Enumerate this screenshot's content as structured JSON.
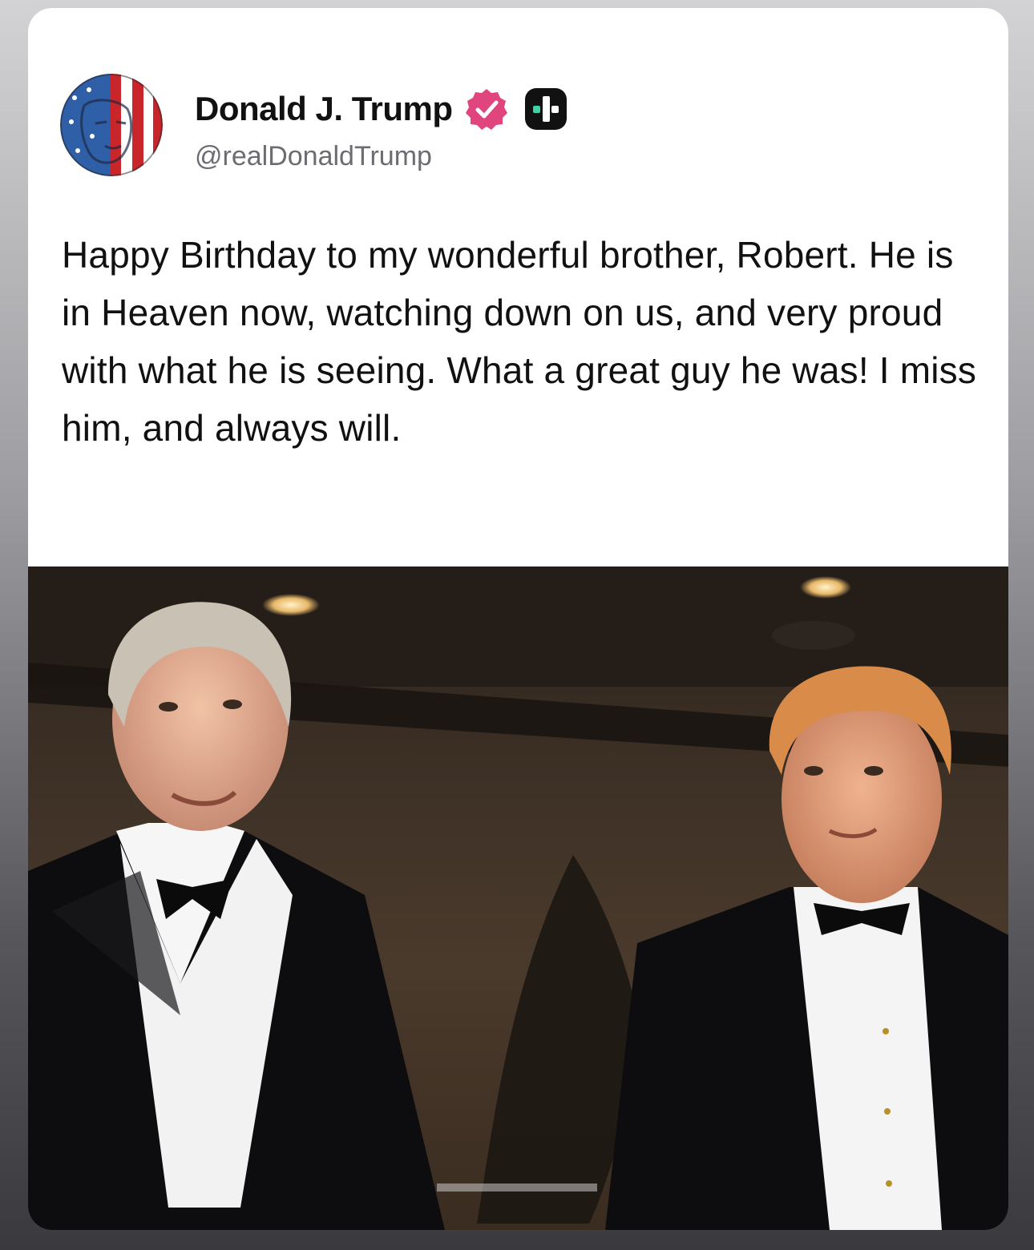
{
  "post": {
    "author": {
      "display_name": "Donald J. Trump",
      "handle": "@realDonaldTrump",
      "avatar_icon": "flag-portrait-avatar",
      "badges": [
        "verified-badge-icon",
        "plus-badge-icon"
      ]
    },
    "text": "Happy Birthday to my wonderful brother, Robert. He is in Heaven now, watching down on us, and very proud with what he is seeing. What a great guy he was! I miss him, and always will.",
    "image": {
      "icon": "photo-two-men-in-tuxedos"
    }
  },
  "colors": {
    "verified": "#e1457d",
    "plus_badge": "#111111",
    "card_bg": "#ffffff"
  }
}
